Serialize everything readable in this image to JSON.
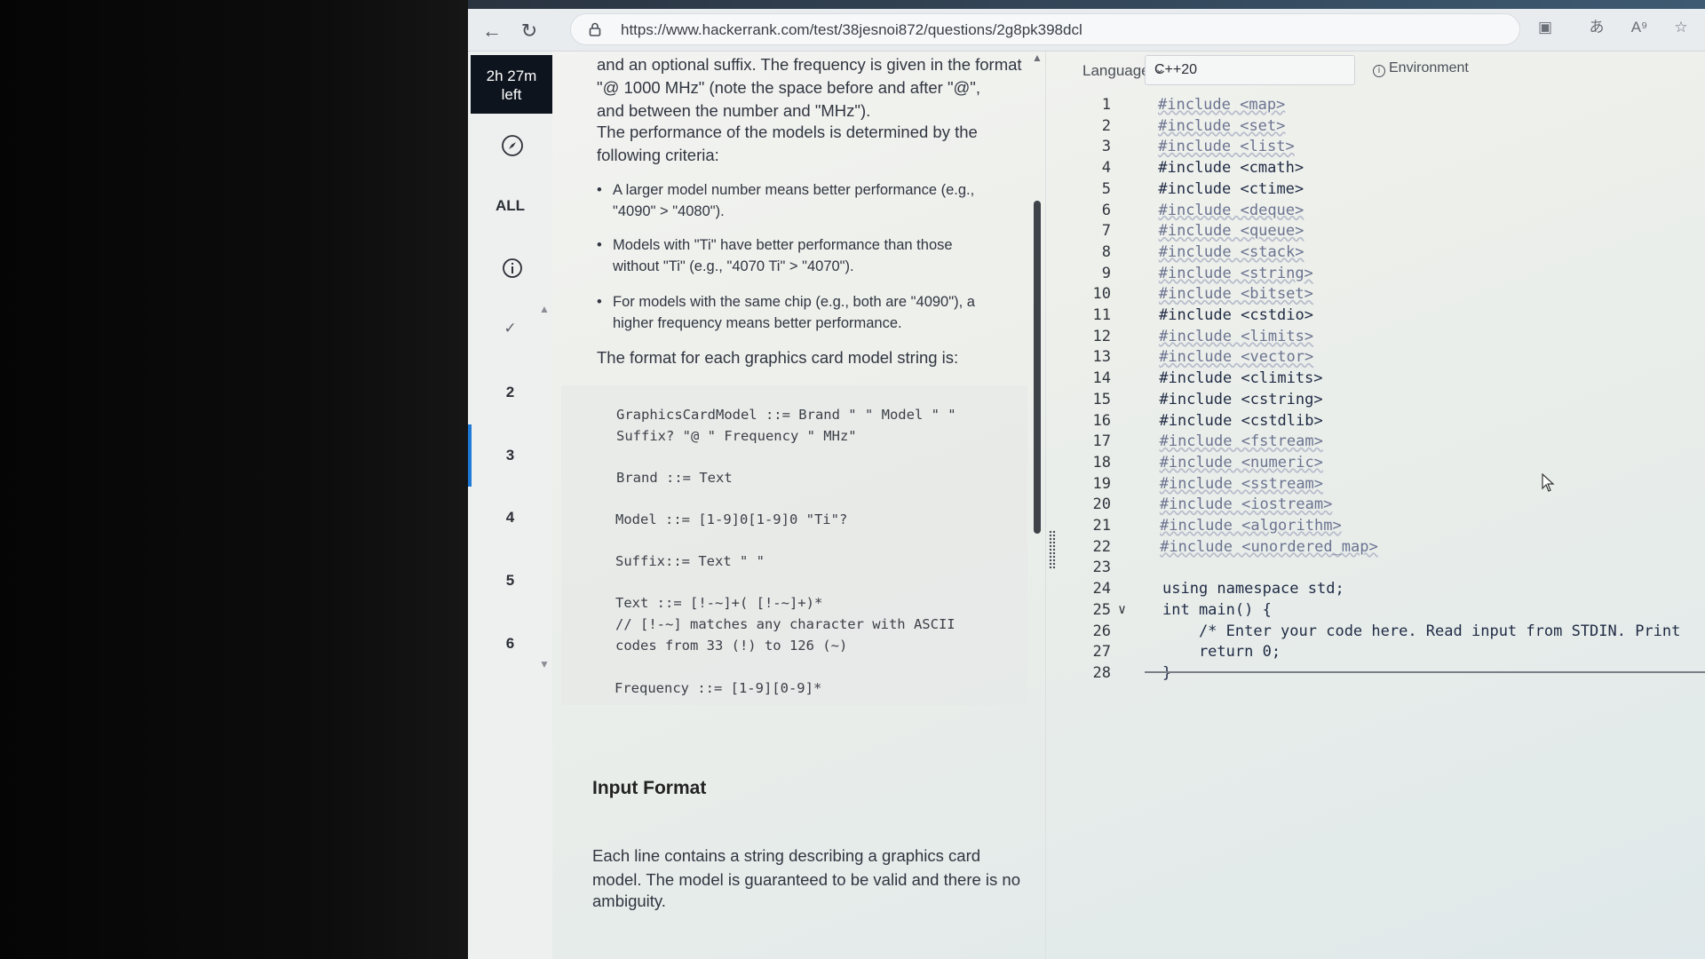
{
  "browser": {
    "url": "https://www.hackerrank.com/test/38jesnoi872/questions/2g8pk398dcl"
  },
  "rail": {
    "timer_line1": "2h 27m",
    "timer_line2": "left",
    "all_label": "ALL",
    "questions": [
      "2",
      "3",
      "4",
      "5",
      "6"
    ]
  },
  "problem": {
    "intro_line1": "and an optional suffix. The frequency is given in the format",
    "intro_line2": "\"@ 1000 MHz\" (note the space before and after \"@\",",
    "intro_line3": "and between the number and \"MHz\").",
    "criteria_line1": "The performance of the models is determined by the",
    "criteria_line2": "following criteria:",
    "bullets": [
      {
        "l1": "A larger model number means better performance (e.g.,",
        "l2": "\"4090\" > \"4080\")."
      },
      {
        "l1": "Models with \"Ti\" have better performance than those",
        "l2": "without \"Ti\" (e.g., \"4070 Ti\" > \"4070\")."
      },
      {
        "l1": "For models with the same chip (e.g., both are \"4090\"), a",
        "l2": "higher frequency means better performance."
      }
    ],
    "format_intro": "The format for each graphics card model string is:",
    "grammar": [
      "GraphicsCardModel ::= Brand \" \" Model \" \"",
      "Suffix? \"@ \" Frequency \" MHz\"",
      "Brand ::= Text",
      "Model ::= [1-9]0[1-9]0 \"Ti\"?",
      "Suffix::= Text \" \"",
      "Text ::= [!-~]+( [!-~]+)*",
      "// [!-~] matches any character with ASCII",
      "codes from 33 (!) to 126 (~)",
      "Frequency ::= [1-9][0-9]*"
    ],
    "input_format_title": "Input Format",
    "input_format_line1": "Each line contains a string describing a graphics card",
    "input_format_line2": "model. The model is guaranteed to be valid and there is no",
    "input_format_line3": "ambiguity."
  },
  "editor": {
    "language_label": "Language",
    "language_value": "C++20",
    "environment_label": "Environment",
    "lines": [
      {
        "n": "1",
        "text": "#include <map>",
        "dim": true
      },
      {
        "n": "2",
        "text": "#include <set>",
        "dim": true
      },
      {
        "n": "3",
        "text": "#include <list>",
        "dim": true
      },
      {
        "n": "4",
        "text": "#include <cmath>",
        "dim": false
      },
      {
        "n": "5",
        "text": "#include <ctime>",
        "dim": false
      },
      {
        "n": "6",
        "text": "#include <deque>",
        "dim": true
      },
      {
        "n": "7",
        "text": "#include <queue>",
        "dim": true
      },
      {
        "n": "8",
        "text": "#include <stack>",
        "dim": true
      },
      {
        "n": "9",
        "text": "#include <string>",
        "dim": true
      },
      {
        "n": "10",
        "text": "#include <bitset>",
        "dim": true
      },
      {
        "n": "11",
        "text": "#include <cstdio>",
        "dim": false
      },
      {
        "n": "12",
        "text": "#include <limits>",
        "dim": true
      },
      {
        "n": "13",
        "text": "#include <vector>",
        "dim": true
      },
      {
        "n": "14",
        "text": "#include <climits>",
        "dim": false
      },
      {
        "n": "15",
        "text": "#include <cstring>",
        "dim": false
      },
      {
        "n": "16",
        "text": "#include <cstdlib>",
        "dim": false
      },
      {
        "n": "17",
        "text": "#include <fstream>",
        "dim": true
      },
      {
        "n": "18",
        "text": "#include <numeric>",
        "dim": true
      },
      {
        "n": "19",
        "text": "#include <sstream>",
        "dim": true
      },
      {
        "n": "20",
        "text": "#include <iostream>",
        "dim": true
      },
      {
        "n": "21",
        "text": "#include <algorithm>",
        "dim": true
      },
      {
        "n": "22",
        "text": "#include <unordered_map>",
        "dim": true
      },
      {
        "n": "23",
        "text": "",
        "dim": false
      },
      {
        "n": "24",
        "text": "using namespace std;",
        "dim": false
      },
      {
        "n": "25",
        "text": "int main() {",
        "dim": false
      },
      {
        "n": "26",
        "text": "    /* Enter your code here. Read input from STDIN. Print",
        "dim": false
      },
      {
        "n": "27",
        "text": "    return 0;",
        "dim": false
      },
      {
        "n": "28",
        "text": "}",
        "dim": false
      }
    ]
  },
  "colors": {
    "timer_bg": "#0e141e",
    "active_accent": "#1d7ad9"
  },
  "icons": [
    "back-arrow-icon",
    "reload-icon",
    "lock-icon",
    "camera-icon",
    "translate-icon",
    "read-aloud-icon",
    "favorite-star-icon",
    "compass-icon",
    "info-icon",
    "check-icon",
    "chevron-down-icon",
    "mouse-pointer-icon"
  ]
}
